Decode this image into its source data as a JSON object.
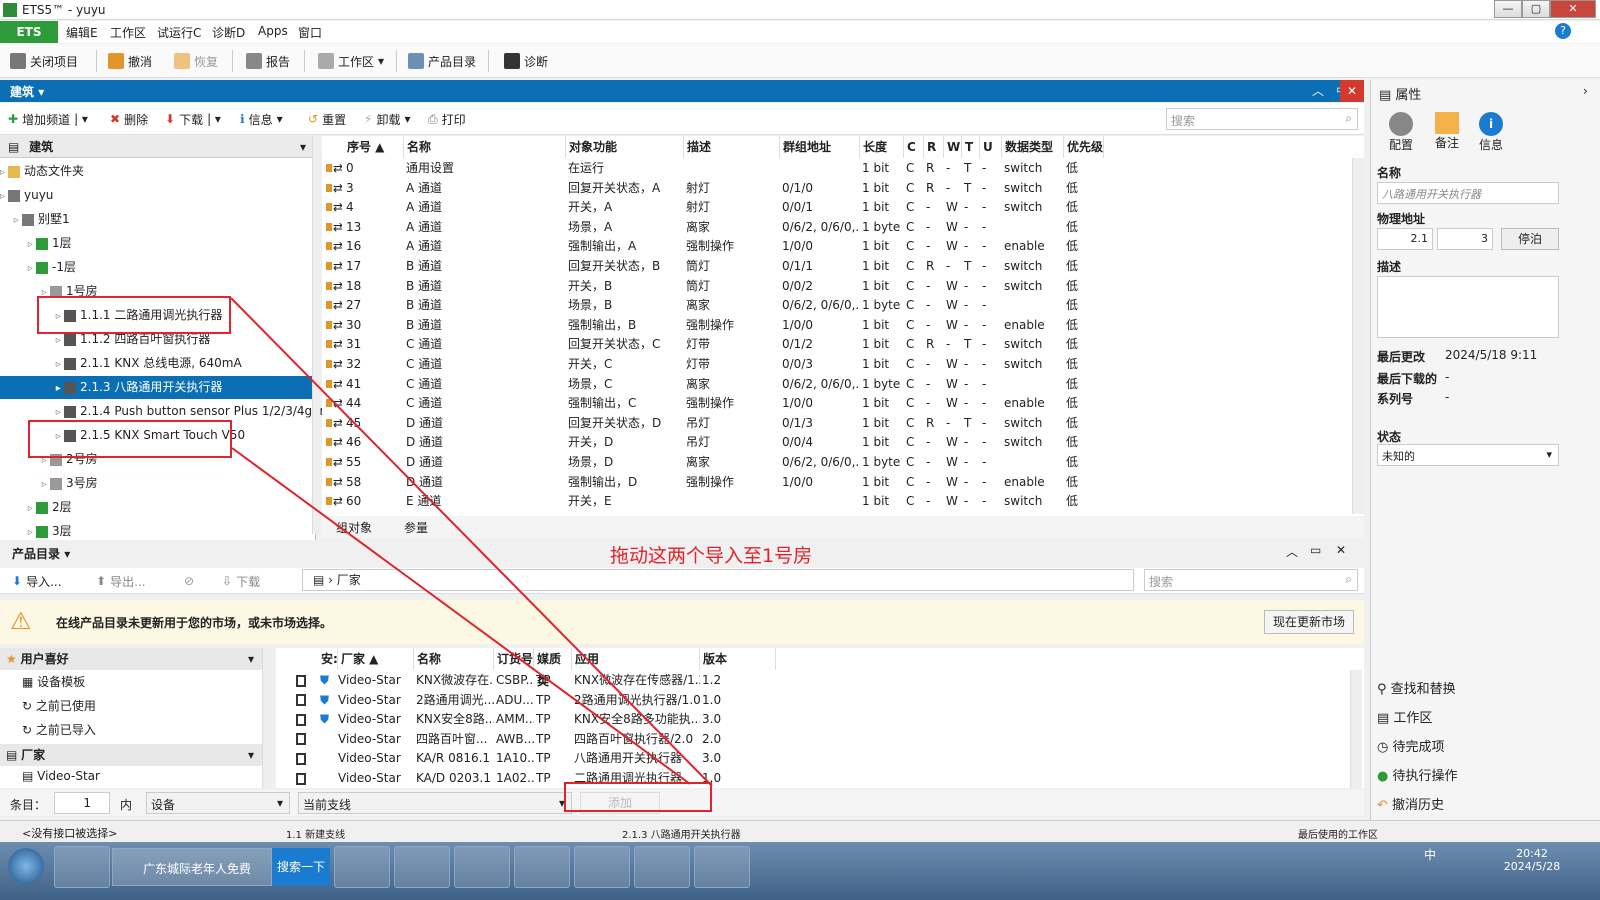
{
  "window": {
    "title": "ETS5™ - yuyu",
    "min": "—",
    "max": "▢",
    "close": "✕"
  },
  "menu": {
    "ets": "ETS",
    "items": [
      "编辑E",
      "工作区",
      "试运行C",
      "诊断D",
      "Apps",
      "窗口"
    ]
  },
  "toolbar": {
    "close": "关闭项目",
    "undo": "撤消",
    "redo": "恢复",
    "report": "报告",
    "workspace": "工作区",
    "catalog": "产品目录",
    "diag": "诊断"
  },
  "building": {
    "title": "建筑",
    "tools": [
      "增加频道",
      "删除",
      "下载",
      "信息",
      "重置",
      "卸载",
      "打印"
    ],
    "search": "搜索",
    "tree_header": "建筑",
    "tree": [
      {
        "label": "动态文件夹",
        "indent": 1,
        "kind": "folder"
      },
      {
        "label": "yuyu",
        "indent": 1,
        "kind": "proj"
      },
      {
        "label": "别墅1",
        "indent": 2,
        "kind": "build"
      },
      {
        "label": "1层",
        "indent": 3,
        "kind": "floor"
      },
      {
        "label": "-1层",
        "indent": 3,
        "kind": "floor"
      },
      {
        "label": "1号房",
        "indent": 4,
        "kind": "room"
      },
      {
        "label": "1.1.1 二路通用调光执行器",
        "indent": 5,
        "kind": "dev"
      },
      {
        "label": "1.1.2 四路百叶窗执行器",
        "indent": 5,
        "kind": "dev"
      },
      {
        "label": "2.1.1 KNX 总线电源, 640mA",
        "indent": 5,
        "kind": "dev"
      },
      {
        "label": "2.1.3 八路通用开关执行器",
        "indent": 5,
        "kind": "dev",
        "selected": true
      },
      {
        "label": "2.1.4 Push button sensor Plus 1/2/3/4gang",
        "indent": 5,
        "kind": "dev"
      },
      {
        "label": "2.1.5 KNX Smart Touch V50",
        "indent": 5,
        "kind": "dev"
      },
      {
        "label": "2号房",
        "indent": 4,
        "kind": "room"
      },
      {
        "label": "3号房",
        "indent": 4,
        "kind": "room"
      },
      {
        "label": "2层",
        "indent": 3,
        "kind": "floor"
      },
      {
        "label": "3层",
        "indent": 3,
        "kind": "floor"
      }
    ],
    "columns": [
      "序号 ▲",
      "名称",
      "对象功能",
      "描述",
      "群组地址",
      "长度",
      "C",
      "R",
      "W",
      "T",
      "U",
      "数据类型",
      "优先级"
    ],
    "rows": [
      [
        "0",
        "通用设置",
        "在运行",
        "",
        "",
        "1 bit",
        "C",
        "R",
        "-",
        "T",
        "-",
        "switch",
        "低"
      ],
      [
        "3",
        "A 通道",
        "回复开关状态，A",
        "射灯",
        "0/1/0",
        "1 bit",
        "C",
        "R",
        "-",
        "T",
        "-",
        "switch",
        "低"
      ],
      [
        "4",
        "A 通道",
        "开关，A",
        "射灯",
        "0/0/1",
        "1 bit",
        "C",
        "-",
        "W",
        "-",
        "-",
        "switch",
        "低"
      ],
      [
        "13",
        "A 通道",
        "场景，A",
        "离家",
        "0/6/2, 0/6/0,...",
        "1 byte",
        "C",
        "-",
        "W",
        "-",
        "-",
        "",
        "低"
      ],
      [
        "16",
        "A 通道",
        "强制输出，A",
        "强制操作",
        "1/0/0",
        "1 bit",
        "C",
        "-",
        "W",
        "-",
        "-",
        "enable",
        "低"
      ],
      [
        "17",
        "B 通道",
        "回复开关状态，B",
        "筒灯",
        "0/1/1",
        "1 bit",
        "C",
        "R",
        "-",
        "T",
        "-",
        "switch",
        "低"
      ],
      [
        "18",
        "B 通道",
        "开关，B",
        "筒灯",
        "0/0/2",
        "1 bit",
        "C",
        "-",
        "W",
        "-",
        "-",
        "switch",
        "低"
      ],
      [
        "27",
        "B 通道",
        "场景，B",
        "离家",
        "0/6/2, 0/6/0,...",
        "1 byte",
        "C",
        "-",
        "W",
        "-",
        "-",
        "",
        "低"
      ],
      [
        "30",
        "B 通道",
        "强制输出，B",
        "强制操作",
        "1/0/0",
        "1 bit",
        "C",
        "-",
        "W",
        "-",
        "-",
        "enable",
        "低"
      ],
      [
        "31",
        "C 通道",
        "回复开关状态，C",
        "灯带",
        "0/1/2",
        "1 bit",
        "C",
        "R",
        "-",
        "T",
        "-",
        "switch",
        "低"
      ],
      [
        "32",
        "C 通道",
        "开关，C",
        "灯带",
        "0/0/3",
        "1 bit",
        "C",
        "-",
        "W",
        "-",
        "-",
        "switch",
        "低"
      ],
      [
        "41",
        "C 通道",
        "场景，C",
        "离家",
        "0/6/2, 0/6/0,...",
        "1 byte",
        "C",
        "-",
        "W",
        "-",
        "-",
        "",
        "低"
      ],
      [
        "44",
        "C 通道",
        "强制输出，C",
        "强制操作",
        "1/0/0",
        "1 bit",
        "C",
        "-",
        "W",
        "-",
        "-",
        "enable",
        "低"
      ],
      [
        "45",
        "D 通道",
        "回复开关状态，D",
        "吊灯",
        "0/1/3",
        "1 bit",
        "C",
        "R",
        "-",
        "T",
        "-",
        "switch",
        "低"
      ],
      [
        "46",
        "D 通道",
        "开关，D",
        "吊灯",
        "0/0/4",
        "1 bit",
        "C",
        "-",
        "W",
        "-",
        "-",
        "switch",
        "低"
      ],
      [
        "55",
        "D 通道",
        "场景，D",
        "离家",
        "0/6/2, 0/6/0,...",
        "1 byte",
        "C",
        "-",
        "W",
        "-",
        "-",
        "",
        "低"
      ],
      [
        "58",
        "D 通道",
        "强制输出，D",
        "强制操作",
        "1/0/0",
        "1 bit",
        "C",
        "-",
        "W",
        "-",
        "-",
        "enable",
        "低"
      ],
      [
        "60",
        "E 通道",
        "开关，E",
        "",
        "",
        "1 bit",
        "C",
        "-",
        "W",
        "-",
        "-",
        "switch",
        "低"
      ]
    ],
    "tabs": [
      "组对象",
      "参量"
    ]
  },
  "annotation": "拖动这两个导入至1号房",
  "catalog": {
    "title": "产品目录",
    "tools": [
      "导入...",
      "导出...",
      "下载"
    ],
    "crumb": "厂家",
    "search": "搜索",
    "warning": "在线产品目录未更新用于您的市场，或未市场选择。",
    "update_btn": "现在更新市场",
    "fav_header": "用户喜好",
    "fav_items": [
      "设备模板",
      "之前已使用",
      "之前已导入"
    ],
    "maker_header": "厂家",
    "maker_item": "Video-Star",
    "columns": [
      "安:",
      "厂家 ▲",
      "名称",
      "订货号",
      "媒质类",
      "应用",
      "版本"
    ],
    "rows": [
      [
        "Video-Star",
        "KNX微波存在...",
        "CSBP...",
        "TP",
        "KNX微波存在传感器/1.2",
        "1.2"
      ],
      [
        "Video-Star",
        "2路通用调光...",
        "ADU...",
        "TP",
        "2路通用调光执行器/1.0",
        "1.0"
      ],
      [
        "Video-Star",
        "KNX安全8路...",
        "AMM...",
        "TP",
        "KNX安全8路多功能执...",
        "3.0"
      ],
      [
        "Video-Star",
        "四路百叶窗...",
        "AWB...",
        "TP",
        "四路百叶窗执行器/2.0",
        "2.0"
      ],
      [
        "Video-Star",
        "KA/R 0816.1",
        "1A10...",
        "TP",
        "八路通用开关执行器",
        "3.0"
      ],
      [
        "Video-Star",
        "KA/D 0203.1",
        "1A02...",
        "TP",
        "二路通用调光执行器",
        "1.0"
      ]
    ],
    "footer": {
      "items_label": "条目：",
      "items_val": "1",
      "in": "内",
      "device": "设备",
      "branch": "当前支线",
      "add": "添加"
    }
  },
  "status": {
    "iface": "<没有接口被选择>",
    "line": "1.1 新建支线",
    "device": "2.1.3 八路通用开关执行器",
    "recent": "最后使用的工作区"
  },
  "props": {
    "title": "属性",
    "tabs": [
      "配置",
      "备注",
      "信息"
    ],
    "name_label": "名称",
    "name_ph": "八路通用开关执行器",
    "addr_label": "物理地址",
    "addr1": "2.1",
    "addr2": "3",
    "park": "停泊",
    "desc_label": "描述",
    "last_mod_l": "最后更改",
    "last_mod": "2024/5/18 9:11",
    "last_dl_l": "最后下载的",
    "last_dl": "-",
    "serial_l": "系列号",
    "serial": "-",
    "state_l": "状态",
    "state": "未知的",
    "links": [
      "查找和替换",
      "工作区",
      "待完成项",
      "待执行操作",
      "撤消历史"
    ]
  },
  "taskbar": {
    "browser": "广东城际老年人免费",
    "search": "搜索一下",
    "time": "20:42",
    "date": "2024/5/28",
    "lang": "中"
  }
}
